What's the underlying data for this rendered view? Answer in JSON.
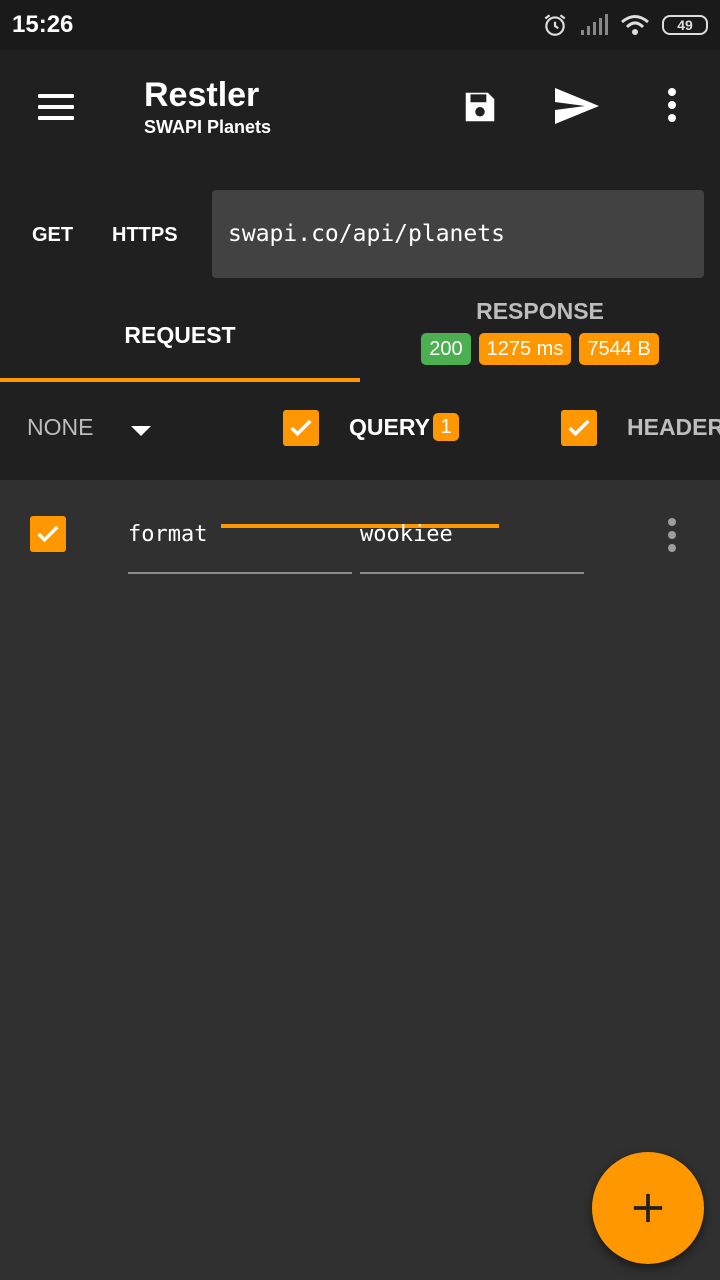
{
  "status_bar": {
    "time": "15:26",
    "battery": "49"
  },
  "app": {
    "title": "Restler",
    "subtitle": "SWAPI Planets"
  },
  "request": {
    "method": "GET",
    "scheme": "HTTPS",
    "url": "swapi.co/api/planets"
  },
  "tabs": {
    "request_label": "REQUEST",
    "response_label": "RESPONSE",
    "response_badges": {
      "status": "200",
      "time": "1275 ms",
      "size": "7544 B"
    }
  },
  "subtabs": {
    "body_type": "NONE",
    "query_label": "QUERY",
    "query_count": "1",
    "headers_label": "HEADERS"
  },
  "params": [
    {
      "key": "format",
      "value": "wookiee",
      "enabled": true
    }
  ],
  "colors": {
    "accent": "#ff9800",
    "success": "#4caf50",
    "appbar": "#202020",
    "background": "#303030"
  },
  "icons": [
    "menu-icon",
    "save-icon",
    "send-icon",
    "more-vert-icon",
    "check-icon",
    "add-icon",
    "alarm-icon",
    "signal-icon",
    "wifi-icon",
    "battery-icon"
  ]
}
